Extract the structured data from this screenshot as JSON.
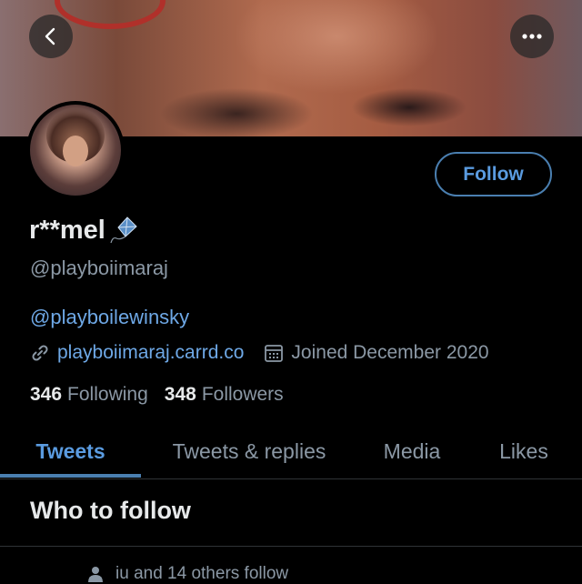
{
  "header": {
    "back_icon": "chevron-left-icon",
    "more_icon": "more-horizontal-icon"
  },
  "profile": {
    "display_name": "r**mel",
    "name_emoji_icon": "kite-icon",
    "handle": "@playboiimaraj",
    "bio_mention": "@playboilewinsky",
    "website": "playboiimaraj.carrd.co",
    "joined": "Joined December 2020",
    "follow_label": "Follow"
  },
  "stats": {
    "following_count": "346",
    "following_label": "Following",
    "followers_count": "348",
    "followers_label": "Followers"
  },
  "tabs": [
    {
      "label": "Tweets",
      "active": true
    },
    {
      "label": "Tweets & replies",
      "active": false
    },
    {
      "label": "Media",
      "active": false
    },
    {
      "label": "Likes",
      "active": false
    }
  ],
  "who_to_follow": {
    "title": "Who to follow",
    "social_context": "iu and 14 others follow"
  },
  "colors": {
    "accent": "#5a9be0",
    "background": "#000000",
    "secondary_text": "#8b98a5"
  }
}
